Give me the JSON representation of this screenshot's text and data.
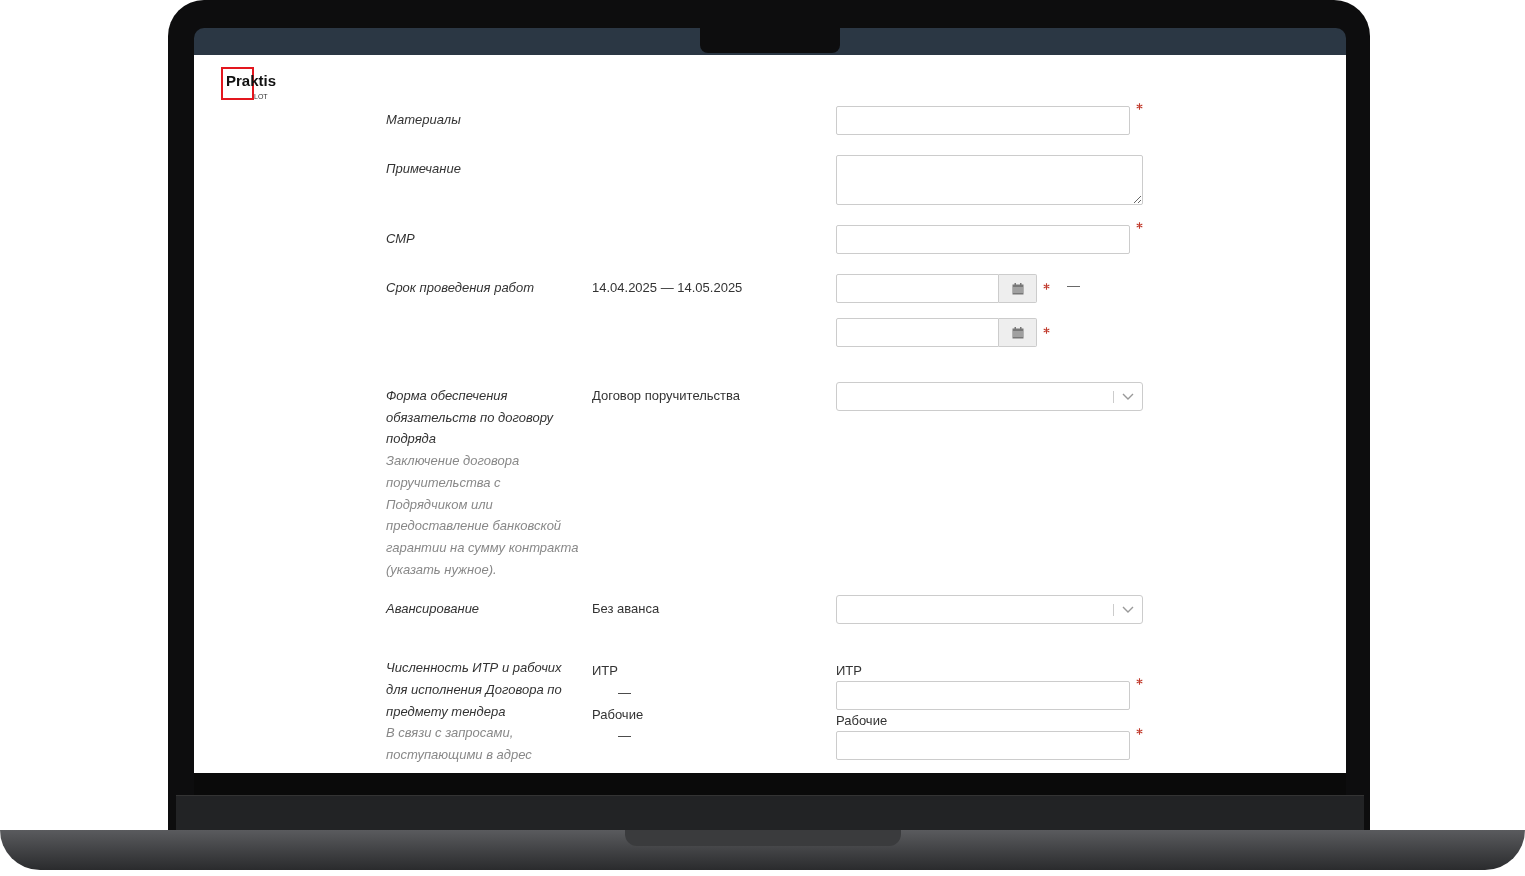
{
  "logo": {
    "name": "Praktis",
    "sub": "LOT"
  },
  "rows": [
    {
      "kind": "input",
      "label": "Материалы",
      "required": true
    },
    {
      "kind": "textarea",
      "label": "Примечание"
    },
    {
      "kind": "input",
      "label": "СМР",
      "required": true
    },
    {
      "kind": "date-range",
      "label": "Срок проведения работ",
      "value": "14.04.2025 — 14.05.2025",
      "separator": "—",
      "required": true
    },
    {
      "kind": "select",
      "label": "Форма обеспечения обязательств по договору подряда",
      "hint": "Заключение договора поручительства с Подрядчиком или предоставление банковской гарантии на сумму контракта (указать нужное).",
      "value": "Договор поручительства"
    },
    {
      "kind": "select",
      "label": "Авансирование",
      "value": "Без аванса"
    },
    {
      "kind": "counts",
      "label": "Численность ИТР и рабочих для исполнения Договора по предмету тендера",
      "hint": "В связи с запросами, поступающими в адрес",
      "items": [
        {
          "label": "ИТР",
          "value": "—",
          "input_label": "ИТР",
          "required": true
        },
        {
          "label": "Рабочие",
          "value": "—",
          "input_label": "Рабочие",
          "required": true
        }
      ]
    }
  ]
}
